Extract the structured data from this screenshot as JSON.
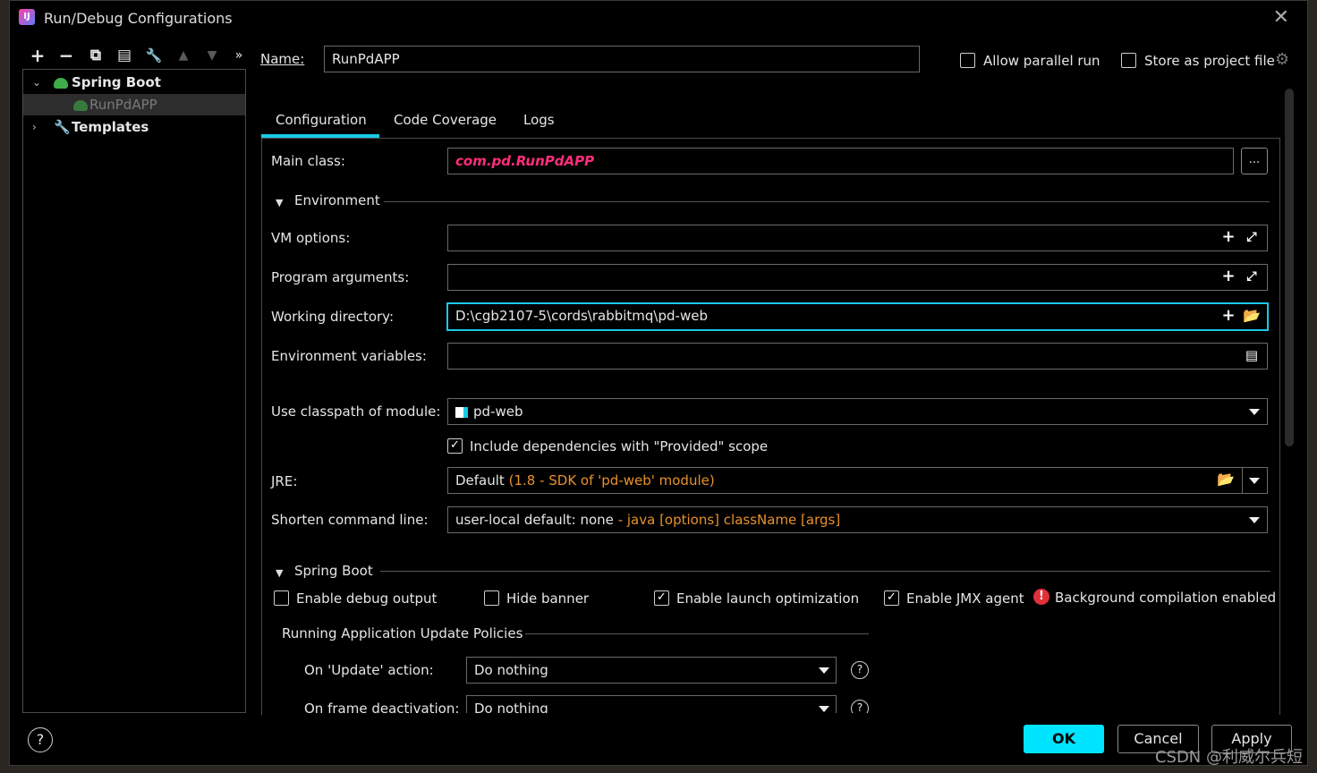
{
  "window": {
    "title": "Run/Debug Configurations",
    "close_glyph": "✕"
  },
  "toolbar": {
    "add": "+",
    "remove": "−",
    "copy": "⧉",
    "save": "▤",
    "edit": "🔧",
    "up": "▲",
    "down": "▼",
    "more": "»"
  },
  "tree": {
    "items": [
      {
        "label": "Spring Boot",
        "expanded": true
      },
      {
        "label": "RunPdAPP",
        "selected": true
      },
      {
        "label": "Templates",
        "expanded": false
      }
    ]
  },
  "header": {
    "name_label": "Name:",
    "name_value": "RunPdAPP",
    "allow_parallel_label": "Allow parallel run",
    "allow_parallel_checked": false,
    "store_project_label": "Store as project file",
    "store_project_checked": false
  },
  "tabs": [
    {
      "label": "Configuration",
      "active": true
    },
    {
      "label": "Code Coverage",
      "active": false
    },
    {
      "label": "Logs",
      "active": false
    }
  ],
  "config": {
    "main_class_label": "Main class:",
    "main_class_value": "com.pd.RunPdAPP",
    "browse_label": "...",
    "environment_label": "Environment",
    "vm_options_label": "VM options:",
    "vm_options_value": "",
    "program_args_label": "Program arguments:",
    "program_args_value": "",
    "working_dir_label": "Working directory:",
    "working_dir_value": "D:\\cgb2107-5\\cords\\rabbitmq\\pd-web",
    "env_vars_label": "Environment variables:",
    "env_vars_value": "",
    "classpath_label": "Use classpath of module:",
    "classpath_value": "pd-web",
    "include_deps_label": "Include dependencies with \"Provided\" scope",
    "include_deps_checked": true,
    "jre_label": "JRE:",
    "jre_value_main": "Default",
    "jre_value_detail": "(1.8 - SDK of 'pd-web' module)",
    "shorten_label": "Shorten command line:",
    "shorten_value_main": "user-local default: none",
    "shorten_value_detail": "- java [options] className [args]"
  },
  "spring_boot": {
    "section_label": "Spring Boot",
    "debug_output_label": "Enable debug output",
    "debug_output_checked": false,
    "hide_banner_label": "Hide banner",
    "hide_banner_checked": false,
    "launch_opt_label": "Enable launch optimization",
    "launch_opt_checked": true,
    "jmx_label": "Enable JMX agent",
    "jmx_checked": true,
    "bg_compile_label": "Background compilation enabled",
    "policies_label": "Running Application Update Policies",
    "on_update_label": "On 'Update' action:",
    "on_update_value": "Do nothing",
    "on_frame_label": "On frame deactivation:",
    "on_frame_value": "Do nothing"
  },
  "footer": {
    "help_glyph": "?",
    "ok_label": "OK",
    "cancel_label": "Cancel",
    "apply_label": "Apply"
  },
  "watermark": "CSDN @利威尔兵短",
  "colors": {
    "accent": "#18c9e8",
    "ok_button": "#00e5ff",
    "main_class": "#ff2d7a",
    "detail_text": "#e8912d"
  }
}
